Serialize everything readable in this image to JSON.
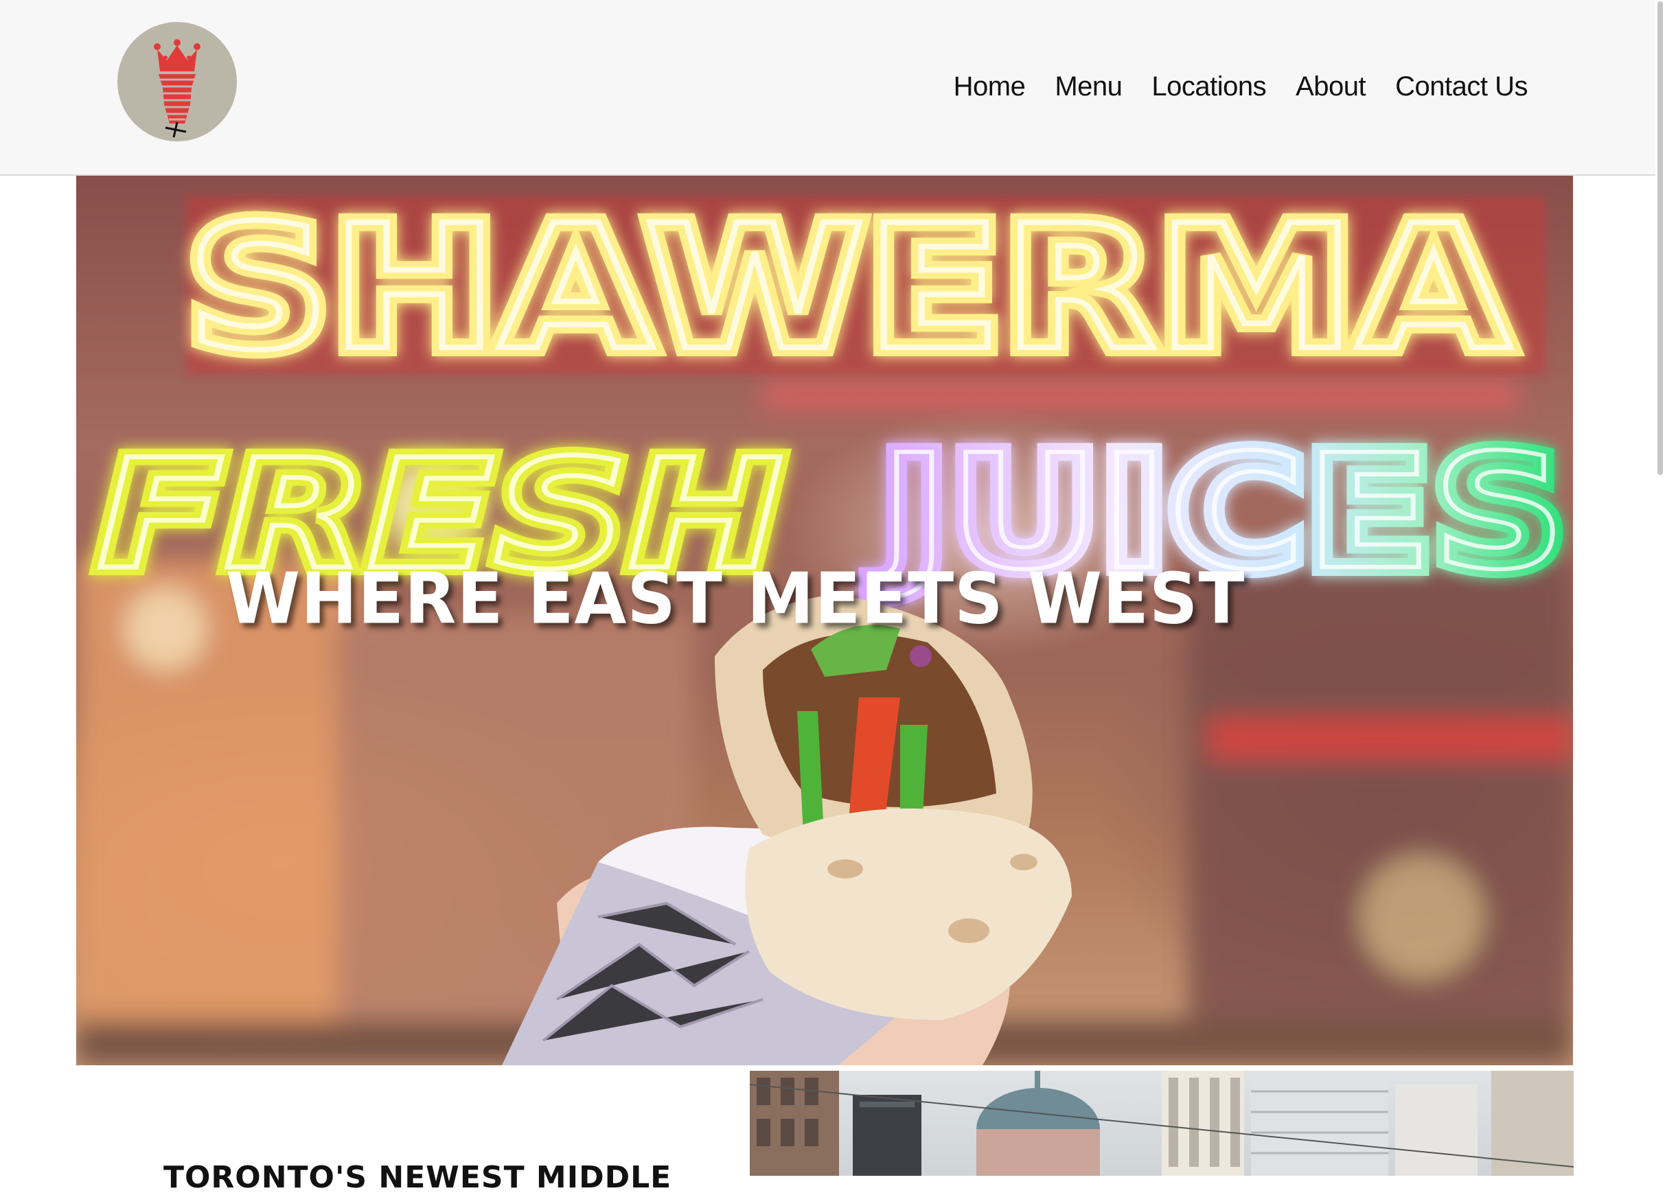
{
  "header": {
    "nav": [
      "Home",
      "Menu",
      "Locations",
      "About",
      "Contact Us"
    ]
  },
  "hero": {
    "title": "WHERE EAST MEETS WEST",
    "sign_line_1": "SHAWERMA",
    "sign_line_2a": "FRESH",
    "sign_line_2b": "JUICES"
  },
  "intro": {
    "title": "TORONTO'S NEWEST MIDDLE"
  },
  "colors": {
    "header_bg": "#f8f7f7",
    "logo_circle": "#bab7a8",
    "logo_red": "#e03b3b",
    "text": "#111111",
    "hero_text": "#ffffff"
  }
}
